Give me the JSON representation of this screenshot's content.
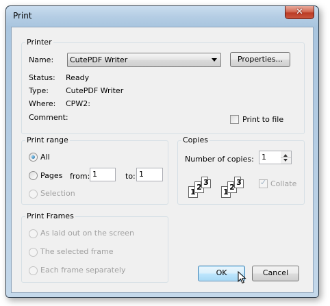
{
  "window": {
    "title": "Print",
    "close_glyph": "✕"
  },
  "printer": {
    "group_title": "Printer",
    "name_label": "Name:",
    "name_value": "CutePDF Writer",
    "properties_button": "Properties...",
    "status_label": "Status:",
    "status_value": "Ready",
    "type_label": "Type:",
    "type_value": "CutePDF Writer",
    "where_label": "Where:",
    "where_value": "CPW2:",
    "comment_label": "Comment:",
    "print_to_file_label": "Print to file",
    "print_to_file_checked": false
  },
  "print_range": {
    "group_title": "Print range",
    "all_label": "All",
    "pages_label": "Pages",
    "from_label": "from:",
    "from_value": "1",
    "to_label": "to:",
    "to_value": "1",
    "selection_label": "Selection",
    "selected": "all"
  },
  "copies": {
    "group_title": "Copies",
    "number_label": "Number of copies:",
    "number_value": "1",
    "collate_label": "Collate",
    "collate_checked": true,
    "page_numbers": [
      "1",
      "2",
      "3"
    ]
  },
  "print_frames": {
    "group_title": "Print Frames",
    "options": [
      "As laid out on the screen",
      "The selected frame",
      "Each frame separately"
    ]
  },
  "buttons": {
    "ok": "OK",
    "cancel": "Cancel"
  },
  "icons": {
    "close": "close-icon",
    "dropdown": "chevron-down-icon",
    "spin": "spinner-arrows-icon",
    "cursor": "mouse-pointer-icon"
  }
}
